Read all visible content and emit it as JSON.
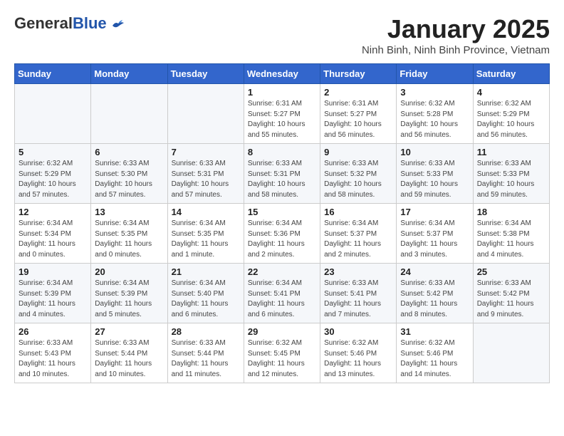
{
  "header": {
    "logo_general": "General",
    "logo_blue": "Blue",
    "month_title": "January 2025",
    "location": "Ninh Binh, Ninh Binh Province, Vietnam"
  },
  "days_of_week": [
    "Sunday",
    "Monday",
    "Tuesday",
    "Wednesday",
    "Thursday",
    "Friday",
    "Saturday"
  ],
  "weeks": [
    [
      {
        "day": "",
        "info": ""
      },
      {
        "day": "",
        "info": ""
      },
      {
        "day": "",
        "info": ""
      },
      {
        "day": "1",
        "info": "Sunrise: 6:31 AM\nSunset: 5:27 PM\nDaylight: 10 hours\nand 55 minutes."
      },
      {
        "day": "2",
        "info": "Sunrise: 6:31 AM\nSunset: 5:27 PM\nDaylight: 10 hours\nand 56 minutes."
      },
      {
        "day": "3",
        "info": "Sunrise: 6:32 AM\nSunset: 5:28 PM\nDaylight: 10 hours\nand 56 minutes."
      },
      {
        "day": "4",
        "info": "Sunrise: 6:32 AM\nSunset: 5:29 PM\nDaylight: 10 hours\nand 56 minutes."
      }
    ],
    [
      {
        "day": "5",
        "info": "Sunrise: 6:32 AM\nSunset: 5:29 PM\nDaylight: 10 hours\nand 57 minutes."
      },
      {
        "day": "6",
        "info": "Sunrise: 6:33 AM\nSunset: 5:30 PM\nDaylight: 10 hours\nand 57 minutes."
      },
      {
        "day": "7",
        "info": "Sunrise: 6:33 AM\nSunset: 5:31 PM\nDaylight: 10 hours\nand 57 minutes."
      },
      {
        "day": "8",
        "info": "Sunrise: 6:33 AM\nSunset: 5:31 PM\nDaylight: 10 hours\nand 58 minutes."
      },
      {
        "day": "9",
        "info": "Sunrise: 6:33 AM\nSunset: 5:32 PM\nDaylight: 10 hours\nand 58 minutes."
      },
      {
        "day": "10",
        "info": "Sunrise: 6:33 AM\nSunset: 5:33 PM\nDaylight: 10 hours\nand 59 minutes."
      },
      {
        "day": "11",
        "info": "Sunrise: 6:33 AM\nSunset: 5:33 PM\nDaylight: 10 hours\nand 59 minutes."
      }
    ],
    [
      {
        "day": "12",
        "info": "Sunrise: 6:34 AM\nSunset: 5:34 PM\nDaylight: 11 hours\nand 0 minutes."
      },
      {
        "day": "13",
        "info": "Sunrise: 6:34 AM\nSunset: 5:35 PM\nDaylight: 11 hours\nand 0 minutes."
      },
      {
        "day": "14",
        "info": "Sunrise: 6:34 AM\nSunset: 5:35 PM\nDaylight: 11 hours\nand 1 minute."
      },
      {
        "day": "15",
        "info": "Sunrise: 6:34 AM\nSunset: 5:36 PM\nDaylight: 11 hours\nand 2 minutes."
      },
      {
        "day": "16",
        "info": "Sunrise: 6:34 AM\nSunset: 5:37 PM\nDaylight: 11 hours\nand 2 minutes."
      },
      {
        "day": "17",
        "info": "Sunrise: 6:34 AM\nSunset: 5:37 PM\nDaylight: 11 hours\nand 3 minutes."
      },
      {
        "day": "18",
        "info": "Sunrise: 6:34 AM\nSunset: 5:38 PM\nDaylight: 11 hours\nand 4 minutes."
      }
    ],
    [
      {
        "day": "19",
        "info": "Sunrise: 6:34 AM\nSunset: 5:39 PM\nDaylight: 11 hours\nand 4 minutes."
      },
      {
        "day": "20",
        "info": "Sunrise: 6:34 AM\nSunset: 5:39 PM\nDaylight: 11 hours\nand 5 minutes."
      },
      {
        "day": "21",
        "info": "Sunrise: 6:34 AM\nSunset: 5:40 PM\nDaylight: 11 hours\nand 6 minutes."
      },
      {
        "day": "22",
        "info": "Sunrise: 6:34 AM\nSunset: 5:41 PM\nDaylight: 11 hours\nand 6 minutes."
      },
      {
        "day": "23",
        "info": "Sunrise: 6:33 AM\nSunset: 5:41 PM\nDaylight: 11 hours\nand 7 minutes."
      },
      {
        "day": "24",
        "info": "Sunrise: 6:33 AM\nSunset: 5:42 PM\nDaylight: 11 hours\nand 8 minutes."
      },
      {
        "day": "25",
        "info": "Sunrise: 6:33 AM\nSunset: 5:42 PM\nDaylight: 11 hours\nand 9 minutes."
      }
    ],
    [
      {
        "day": "26",
        "info": "Sunrise: 6:33 AM\nSunset: 5:43 PM\nDaylight: 11 hours\nand 10 minutes."
      },
      {
        "day": "27",
        "info": "Sunrise: 6:33 AM\nSunset: 5:44 PM\nDaylight: 11 hours\nand 10 minutes."
      },
      {
        "day": "28",
        "info": "Sunrise: 6:33 AM\nSunset: 5:44 PM\nDaylight: 11 hours\nand 11 minutes."
      },
      {
        "day": "29",
        "info": "Sunrise: 6:32 AM\nSunset: 5:45 PM\nDaylight: 11 hours\nand 12 minutes."
      },
      {
        "day": "30",
        "info": "Sunrise: 6:32 AM\nSunset: 5:46 PM\nDaylight: 11 hours\nand 13 minutes."
      },
      {
        "day": "31",
        "info": "Sunrise: 6:32 AM\nSunset: 5:46 PM\nDaylight: 11 hours\nand 14 minutes."
      },
      {
        "day": "",
        "info": ""
      }
    ]
  ]
}
